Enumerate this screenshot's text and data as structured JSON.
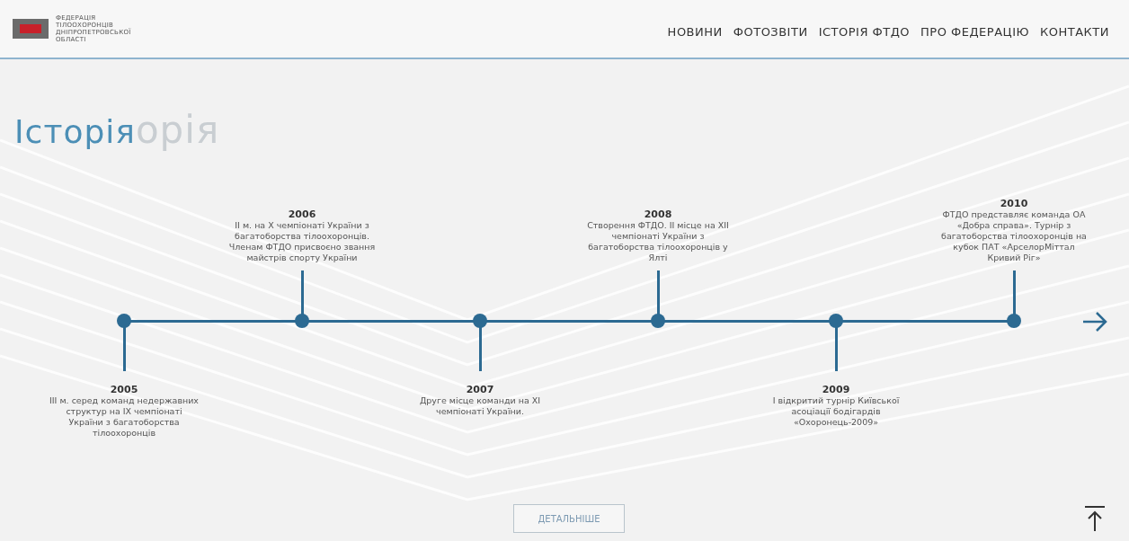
{
  "logo": {
    "text": "ФЕДЕРАЦІЯ ТІЛООХОРОНЦІВ ДНІПРОПЕТРОВСЬКОЇ ОБЛАСТІ"
  },
  "nav": [
    {
      "label": "НОВИНИ"
    },
    {
      "label": "ФОТОЗВІТИ"
    },
    {
      "label": "ІСТОРІЯ ФТДО"
    },
    {
      "label": "ПРО ФЕДЕРАЦІЮ"
    },
    {
      "label": "КОНТАКТИ"
    }
  ],
  "heading": "Історія",
  "background_title": "орія",
  "timeline": [
    {
      "year": "2005",
      "text": "III м. серед команд недержавних структур на IX чемпіонаті України з багатоборства тілоохоронців",
      "kind": "below"
    },
    {
      "year": "2006",
      "text": "II м. на X чемпіонаті України з багатоборства тілоохоронців. Членам ФТДО присвоєно звання майстрів спорту України",
      "kind": "above"
    },
    {
      "year": "2007",
      "text": "Друге місце команди на XI чемпіонаті України.",
      "kind": "below"
    },
    {
      "year": "2008",
      "text": "Створення ФТДО. II місце на XII чемпіонаті України з багатоборства тілоохоронців у Ялті",
      "kind": "above"
    },
    {
      "year": "2009",
      "text": "I відкритий турнір Київської асоціації бодігардів «Охоронець-2009»",
      "kind": "below"
    },
    {
      "year": "2010",
      "text": "ФТДО представляє команда ОА «Добра справа». Турнір з багатоборства тілоохоронців на кубок ПАТ «АрселорМіттал Кривий Ріг»",
      "kind": "above"
    }
  ],
  "more_button": "ДЕТАЛЬНІШЕ"
}
